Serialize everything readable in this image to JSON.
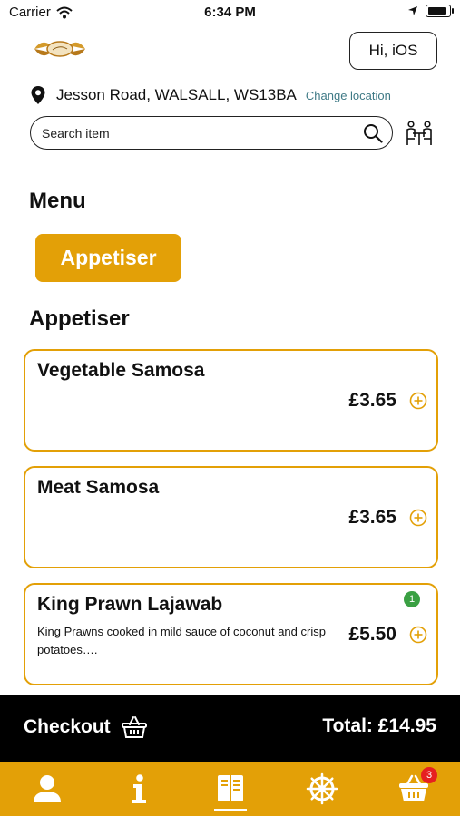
{
  "status_bar": {
    "carrier": "Carrier",
    "time": "6:34 PM"
  },
  "header": {
    "greeting_button": "Hi, iOS"
  },
  "location": {
    "address": "Jesson Road, WALSALL, WS13BA",
    "change_label": "Change location"
  },
  "search": {
    "placeholder": "Search item"
  },
  "menu": {
    "title": "Menu",
    "categories": [
      "Appetiser"
    ],
    "section_title": "Appetiser",
    "items": [
      {
        "name": "Vegetable Samosa",
        "description": "",
        "price": "£3.65",
        "count": ""
      },
      {
        "name": "Meat Samosa",
        "description": "",
        "price": "£3.65",
        "count": ""
      },
      {
        "name": "King Prawn Lajawab",
        "description": "King Prawns cooked in mild sauce of coconut and crisp potatoes….",
        "price": "£5.50",
        "count": "1"
      }
    ]
  },
  "checkout_bar": {
    "checkout_label": "Checkout",
    "total_label": "Total: £14.95"
  },
  "tab_bar": {
    "tabs": [
      "profile-icon",
      "info-icon",
      "menu-icon",
      "wheel-icon",
      "basket-icon"
    ],
    "active": "menu-icon",
    "cart_badge": "3"
  },
  "colors": {
    "accent": "#e3a007",
    "link": "#3f7a86",
    "badge_green": "#3aa043",
    "badge_red": "#e62020"
  }
}
